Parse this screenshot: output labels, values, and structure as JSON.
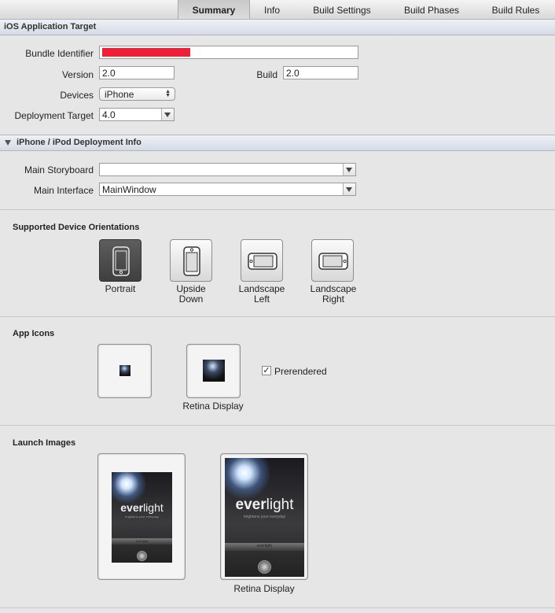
{
  "tabs": [
    {
      "label": "Summary",
      "selected": true
    },
    {
      "label": "Info",
      "selected": false
    },
    {
      "label": "Build Settings",
      "selected": false
    },
    {
      "label": "Build Phases",
      "selected": false
    },
    {
      "label": "Build Rules",
      "selected": false
    }
  ],
  "ios_target": {
    "header": "iOS Application Target",
    "bundle_identifier_label": "Bundle Identifier",
    "bundle_identifier_value": "",
    "version_label": "Version",
    "version_value": "2.0",
    "build_label": "Build",
    "build_value": "2.0",
    "devices_label": "Devices",
    "devices_value": "iPhone",
    "deployment_label": "Deployment Target",
    "deployment_value": "4.0"
  },
  "deployment_info": {
    "header": "iPhone / iPod Deployment Info",
    "storyboard_label": "Main Storyboard",
    "storyboard_value": "",
    "interface_label": "Main Interface",
    "interface_value": "MainWindow"
  },
  "orientations": {
    "title": "Supported Device Orientations",
    "items": [
      {
        "label": "Portrait",
        "selected": true
      },
      {
        "label": "Upside Down",
        "selected": false
      },
      {
        "label": "Landscape Left",
        "selected": false
      },
      {
        "label": "Landscape Right",
        "selected": false
      }
    ]
  },
  "app_icons": {
    "title": "App Icons",
    "retina_caption": "Retina Display",
    "prerendered_label": "Prerendered",
    "prerendered_checked": true,
    "checkmark": "✓"
  },
  "launch_images": {
    "title": "Launch Images",
    "retina_caption": "Retina Display",
    "brand_bold": "ever",
    "brand_rest": "light",
    "tagline": "brightens your everyday",
    "stripe_text": "everlight"
  },
  "colors": {
    "selected_orientation": "#4a4a4a",
    "redaction": "#f01f35"
  }
}
